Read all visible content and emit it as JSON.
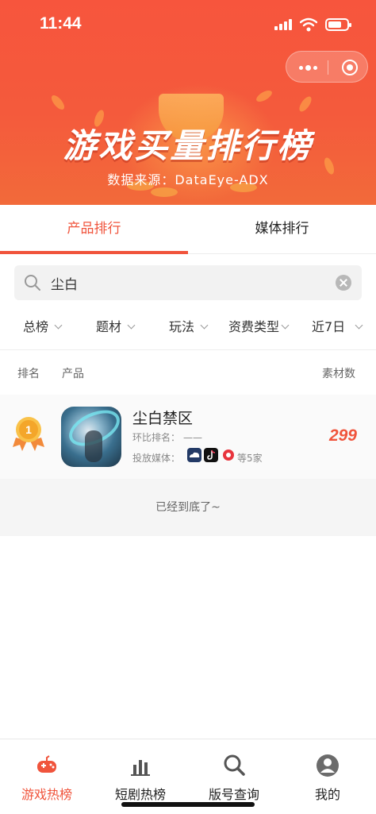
{
  "status_bar": {
    "time": "11:44"
  },
  "banner": {
    "title": "游戏买量排行榜",
    "subtitle": "数据来源：DataEye-ADX"
  },
  "tabs": [
    {
      "label": "产品排行",
      "active": true
    },
    {
      "label": "媒体排行",
      "active": false
    }
  ],
  "search": {
    "value": "尘白",
    "icon": "search-icon"
  },
  "filters": [
    {
      "label": "总榜"
    },
    {
      "label": "题材"
    },
    {
      "label": "玩法"
    },
    {
      "label": "资费类型"
    },
    {
      "label": "近7日"
    }
  ],
  "table": {
    "headers": {
      "rank": "排名",
      "product": "产品",
      "count": "素材数"
    },
    "rows": [
      {
        "rank": 1,
        "name": "尘白禁区",
        "rank_change_label": "环比排名：",
        "rank_change_value": "——",
        "media_label": "投放媒体：",
        "media_more": "等5家",
        "media_icons": [
          "cloud-media-icon",
          "tiktok-icon",
          "red-circle-media-icon"
        ],
        "count": "299"
      }
    ],
    "end_text": "已经到底了~"
  },
  "bottom_nav": [
    {
      "label": "游戏热榜",
      "icon": "gamepad-icon",
      "active": true
    },
    {
      "label": "短剧热榜",
      "icon": "bar-chart-icon",
      "active": false
    },
    {
      "label": "版号查询",
      "icon": "search-icon",
      "active": false
    },
    {
      "label": "我的",
      "icon": "user-icon",
      "active": false
    }
  ],
  "colors": {
    "accent": "#f0543c",
    "banner": "#f7553d",
    "medal": "#f4a62a"
  }
}
